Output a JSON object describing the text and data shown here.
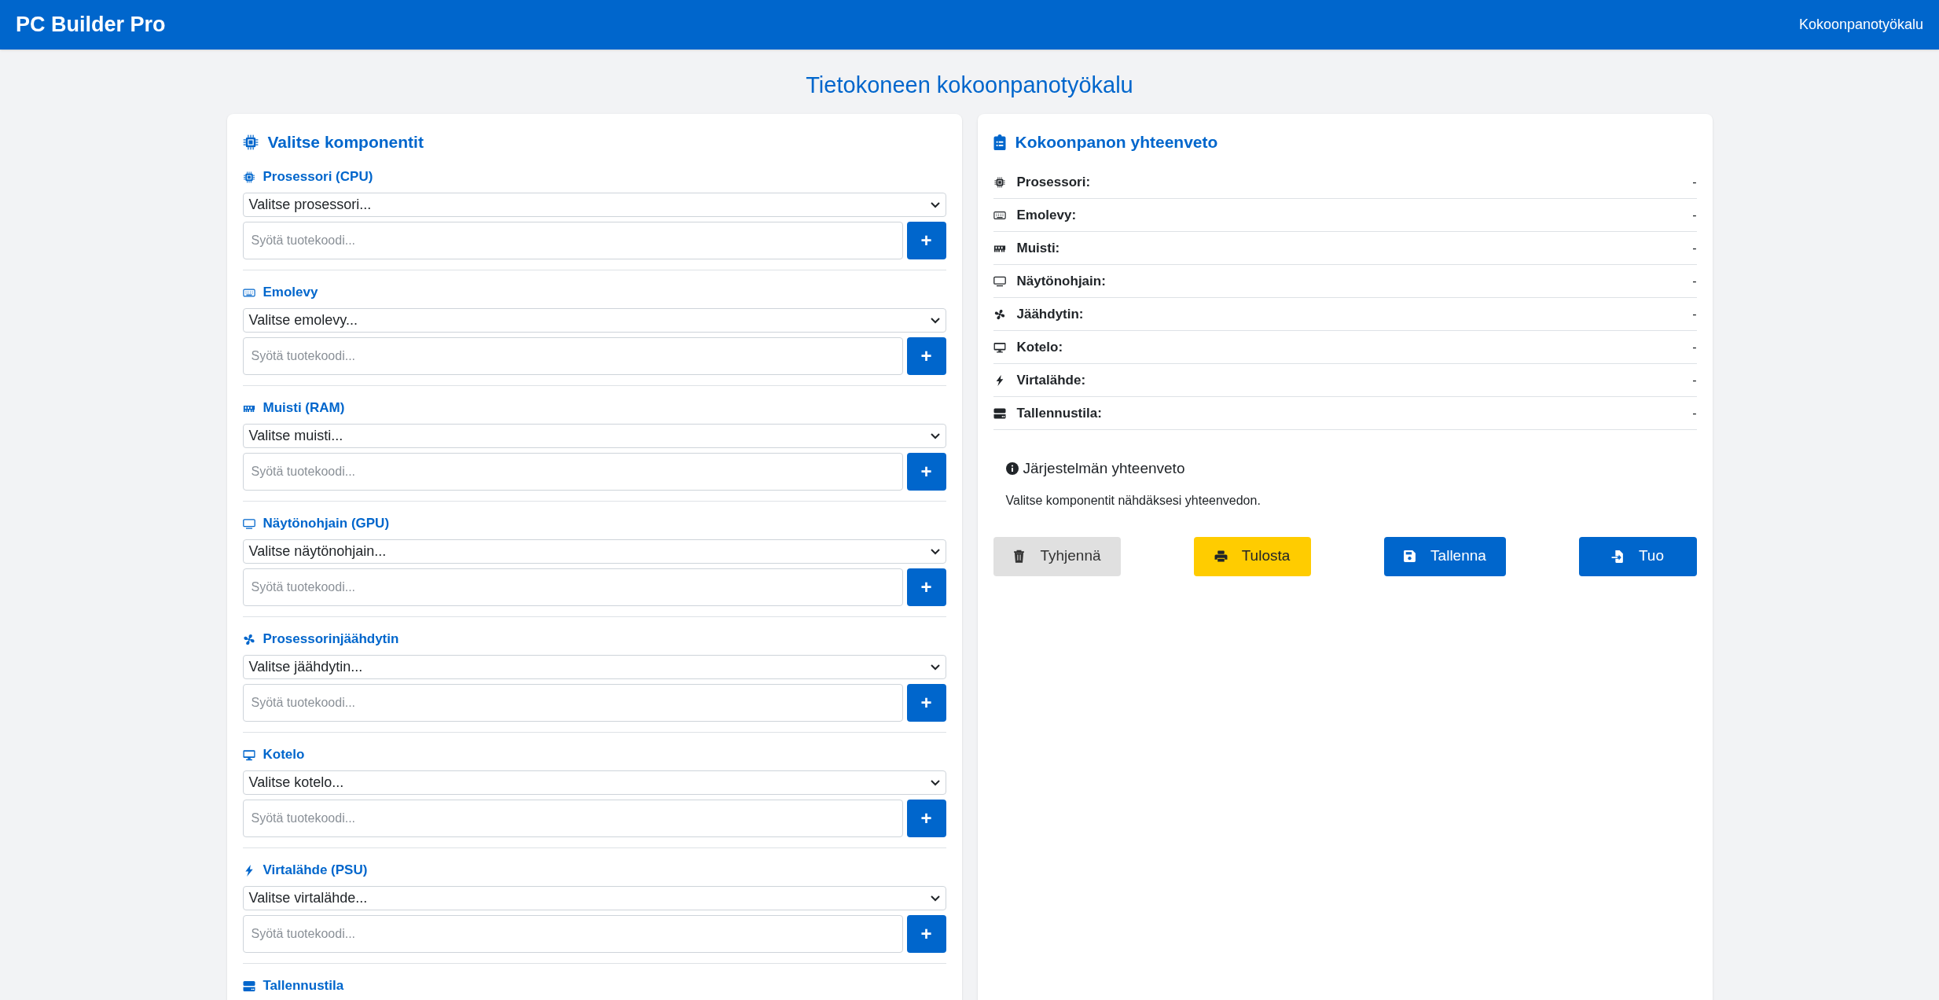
{
  "header": {
    "brand": "PC Builder Pro",
    "nav_link": "Kokoonpanotyökalu"
  },
  "page_title": "Tietokoneen kokoonpanotyökalu",
  "components_panel": {
    "title": "Valitse komponentit",
    "sections": [
      {
        "kind": "cpu",
        "label": "Prosessori (CPU)",
        "select": "Valitse prosessori...",
        "placeholder": "Syötä tuotekoodi...",
        "add_button": "+"
      },
      {
        "kind": "board",
        "label": "Emolevy",
        "select": "Valitse emolevy...",
        "placeholder": "Syötä tuotekoodi...",
        "add_button": "+"
      },
      {
        "kind": "ram",
        "label": "Muisti (RAM)",
        "select": "Valitse muisti...",
        "placeholder": "Syötä tuotekoodi...",
        "add_button": "+"
      },
      {
        "kind": "gpu",
        "label": "Näytönohjain (GPU)",
        "select": "Valitse näytönohjain...",
        "placeholder": "Syötä tuotekoodi...",
        "add_button": "+"
      },
      {
        "kind": "cooler",
        "label": "Prosessorinjäähdytin",
        "select": "Valitse jäähdytin...",
        "placeholder": "Syötä tuotekoodi...",
        "add_button": "+"
      },
      {
        "kind": "case",
        "label": "Kotelo",
        "select": "Valitse kotelo...",
        "placeholder": "Syötä tuotekoodi...",
        "add_button": "+"
      },
      {
        "kind": "psu",
        "label": "Virtalähde (PSU)",
        "select": "Valitse virtalähde...",
        "placeholder": "Syötä tuotekoodi...",
        "add_button": "+"
      },
      {
        "kind": "storage",
        "label": "Tallennustila"
      }
    ]
  },
  "summary_panel": {
    "title": "Kokoonpanon yhteenveto",
    "rows": [
      {
        "kind": "cpu",
        "label": "Prosessori:",
        "value": "-"
      },
      {
        "kind": "board",
        "label": "Emolevy:",
        "value": "-"
      },
      {
        "kind": "ram",
        "label": "Muisti:",
        "value": "-"
      },
      {
        "kind": "gpu",
        "label": "Näytönohjain:",
        "value": "-"
      },
      {
        "kind": "cooler",
        "label": "Jäähdytin:",
        "value": "-"
      },
      {
        "kind": "case",
        "label": "Kotelo:",
        "value": "-"
      },
      {
        "kind": "psu",
        "label": "Virtalähde:",
        "value": "-"
      },
      {
        "kind": "storage",
        "label": "Tallennustila:",
        "value": "-"
      }
    ],
    "system_summary": {
      "title": "Järjestelmän yhteenveto",
      "text": "Valitse komponentit nähdäksesi yhteenvedon."
    },
    "buttons": [
      {
        "kind": "clear",
        "label": "Tyhjennä"
      },
      {
        "kind": "print",
        "label": "Tulosta"
      },
      {
        "kind": "save",
        "label": "Tallenna"
      },
      {
        "kind": "import",
        "label": "Tuo"
      }
    ]
  }
}
